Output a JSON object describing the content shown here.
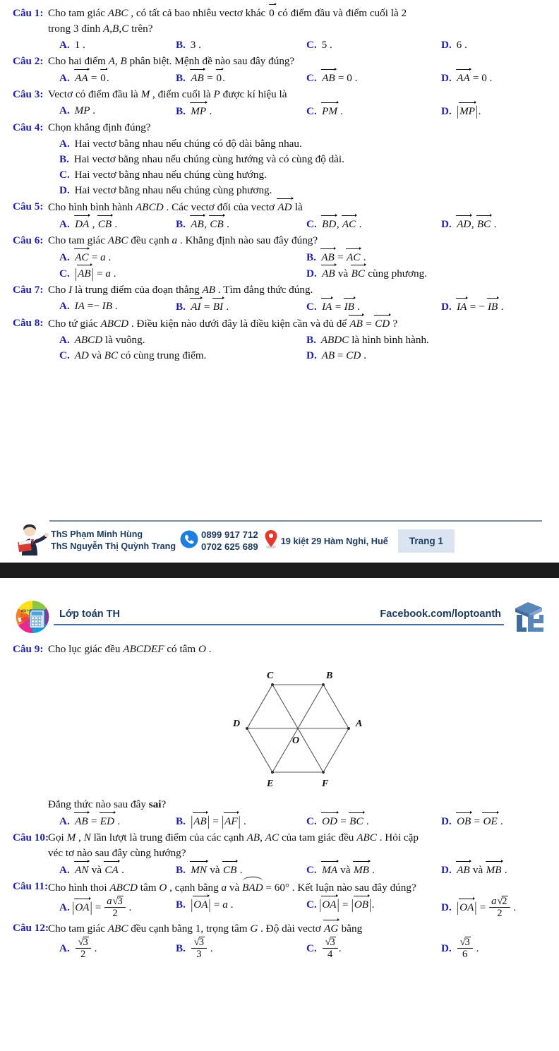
{
  "document": {
    "title": "Đề trắc nghiệm vectơ - Lớp toán TH",
    "question_label_prefix": "Câu",
    "colors": {
      "question_label": "#1f1fa8",
      "option_letter": "#1f1fa8",
      "footer_text": "#1b3a5e",
      "badge_bg": "#dbe5f1",
      "rule": "#7a8da3",
      "page_separator": "#1b1b1b"
    }
  },
  "page1": {
    "questions": [
      {
        "number": "Câu 1:",
        "stem": "Cho tam giác ABC , có tất cả bao nhiêu vectơ khác 0 có điểm đầu và điểm cuối là 2 trong 3 đỉnh A,B,C trên?",
        "layout": "row4",
        "options": [
          {
            "letter": "A.",
            "text": "1 ."
          },
          {
            "letter": "B.",
            "text": "3 ."
          },
          {
            "letter": "C.",
            "text": "5 ."
          },
          {
            "letter": "D.",
            "text": "6 ."
          }
        ]
      },
      {
        "number": "Câu 2:",
        "stem": "Cho hai điểm A, B phân biệt. Mệnh đề nào sau đây đúng?",
        "layout": "row4",
        "options": [
          {
            "letter": "A.",
            "text": "AA = 0."
          },
          {
            "letter": "B.",
            "text": "AB = 0."
          },
          {
            "letter": "C.",
            "text": "AB = 0 ."
          },
          {
            "letter": "D.",
            "text": "AA = 0 ."
          }
        ]
      },
      {
        "number": "Câu 3:",
        "stem": "Vectơ có điểm đầu là M , điểm cuối là P được kí hiệu là",
        "layout": "row4",
        "options": [
          {
            "letter": "A.",
            "text": "MP ."
          },
          {
            "letter": "B.",
            "text": "MP ."
          },
          {
            "letter": "C.",
            "text": "PM ."
          },
          {
            "letter": "D.",
            "text": "|MP| ."
          }
        ]
      },
      {
        "number": "Câu 4:",
        "stem": "Chọn khẳng định đúng?",
        "layout": "stack",
        "options": [
          {
            "letter": "A.",
            "text": "Hai vectơ bằng nhau nếu chúng có độ dài bằng nhau."
          },
          {
            "letter": "B.",
            "text": "Hai vectơ bằng nhau nếu chúng cùng hướng và có cùng độ dài."
          },
          {
            "letter": "C.",
            "text": "Hai vectơ bằng nhau nếu chúng cùng hướng."
          },
          {
            "letter": "D.",
            "text": "Hai vectơ bằng nhau nếu chúng cùng phương."
          }
        ]
      },
      {
        "number": "Câu 5:",
        "stem": "Cho hình bình hành ABCD . Các vectơ đối của vectơ AD là",
        "layout": "row4",
        "options": [
          {
            "letter": "A.",
            "text": "DA , CB ."
          },
          {
            "letter": "B.",
            "text": "AB, CB ."
          },
          {
            "letter": "C.",
            "text": "BD, AC ."
          },
          {
            "letter": "D.",
            "text": "AD, BC ."
          }
        ]
      },
      {
        "number": "Câu 6:",
        "stem": "Cho tam giác ABC đều cạnh a . Khẳng định nào sau đây đúng?",
        "layout": "grid2",
        "options": [
          {
            "letter": "A.",
            "text": "AC = a ."
          },
          {
            "letter": "B.",
            "text": "AB = AC ."
          },
          {
            "letter": "C.",
            "text": "|AB| = a ."
          },
          {
            "letter": "D.",
            "text": "AB và BC cùng phương."
          }
        ]
      },
      {
        "number": "Câu 7:",
        "stem": "Cho I là trung điểm của đoạn thẳng AB . Tìm đẳng thức đúng.",
        "layout": "row4",
        "options": [
          {
            "letter": "A.",
            "text": "IA = − IB ."
          },
          {
            "letter": "B.",
            "text": "AI = BI ."
          },
          {
            "letter": "C.",
            "text": "IA = IB ."
          },
          {
            "letter": "D.",
            "text": "IA = − IB ."
          }
        ]
      },
      {
        "number": "Câu 8:",
        "stem": "Cho tứ giác ABCD . Điều kiện nào dưới đây là điều kiện cần và đủ để AB = CD ?",
        "layout": "grid2",
        "options": [
          {
            "letter": "A.",
            "text": "ABCD là vuông."
          },
          {
            "letter": "B.",
            "text": "ABDC là hình bình hành."
          },
          {
            "letter": "C.",
            "text": "AD và BC có cùng trung điểm."
          },
          {
            "letter": "D.",
            "text": "AB = CD ."
          }
        ]
      }
    ],
    "footer": {
      "teacher_1": "ThS Phạm Minh Hùng",
      "teacher_2": "ThS Nguyễn Thị Quỳnh Trang",
      "phone_1": "0899 917 712",
      "phone_2": "0702 625 689",
      "address": "19 kiệt 29 Hàm Nghi, Huế",
      "page_badge": "Trang 1",
      "phone_icon": "phone-icon",
      "pin_icon": "map-pin-icon",
      "teacher_icon": "teacher-avatar-icon"
    }
  },
  "page2": {
    "header": {
      "brand": "Lớp toán TH",
      "facebook": "Facebook.com/loptoanth",
      "brand_logo_icon": "calculator-logo-icon",
      "ut_logo_icon": "ut-cube-logo-icon"
    },
    "questions": [
      {
        "number": "Câu 9:",
        "stem": "Cho lục giác đều ABCDEF có tâm O .",
        "figure": {
          "type": "hexagon",
          "name": "regular-hexagon-figure",
          "center_label": "O",
          "vertices": [
            {
              "label": "A",
              "position": "right"
            },
            {
              "label": "B",
              "position": "top-right"
            },
            {
              "label": "C",
              "position": "top-left"
            },
            {
              "label": "D",
              "position": "left"
            },
            {
              "label": "E",
              "position": "bottom-left"
            },
            {
              "label": "F",
              "position": "bottom-right"
            }
          ]
        },
        "sub_stem": "Đẳng thức nào sau đây sai?",
        "layout": "row4",
        "options": [
          {
            "letter": "A.",
            "text": "AB = ED ."
          },
          {
            "letter": "B.",
            "text": "|AB| = |AF| ."
          },
          {
            "letter": "C.",
            "text": "OD = BC ."
          },
          {
            "letter": "D.",
            "text": "OB = OE ."
          }
        ]
      },
      {
        "number": "Câu 10:",
        "stem": "Gọi M , N lần lượt là trung điểm của các cạnh AB, AC của tam giác đều ABC . Hỏi cặp véc tơ nào sau đây cùng hướng?",
        "layout": "row4",
        "options": [
          {
            "letter": "A.",
            "text": "AN và CA ."
          },
          {
            "letter": "B.",
            "text": "MN và CB ."
          },
          {
            "letter": "C.",
            "text": "MA và MB ."
          },
          {
            "letter": "D.",
            "text": "AB và MB ."
          }
        ]
      },
      {
        "number": "Câu 11:",
        "stem": "Cho hình thoi ABCD tâm O , cạnh bằng a và BAD = 60° . Kết luận nào sau đây đúng?",
        "layout": "row4",
        "options": [
          {
            "letter": "A.",
            "text": "|OA| = a√3 / 2 ."
          },
          {
            "letter": "B.",
            "text": "|OA| = a ."
          },
          {
            "letter": "C.",
            "text": "|OA| = |OB| ."
          },
          {
            "letter": "D.",
            "text": "|OA| = a√2 / 2 ."
          }
        ]
      },
      {
        "number": "Câu 12:",
        "stem": "Cho tam giác ABC đều cạnh bằng 1, trọng tâm G . Độ dài vectơ AG bằng",
        "layout": "row4",
        "options": [
          {
            "letter": "A.",
            "text": "√3 / 2 ."
          },
          {
            "letter": "B.",
            "text": "√3 / 3 ."
          },
          {
            "letter": "C.",
            "text": "√3 / 4 ."
          },
          {
            "letter": "D.",
            "text": "√3 / 6 ."
          }
        ]
      }
    ]
  }
}
